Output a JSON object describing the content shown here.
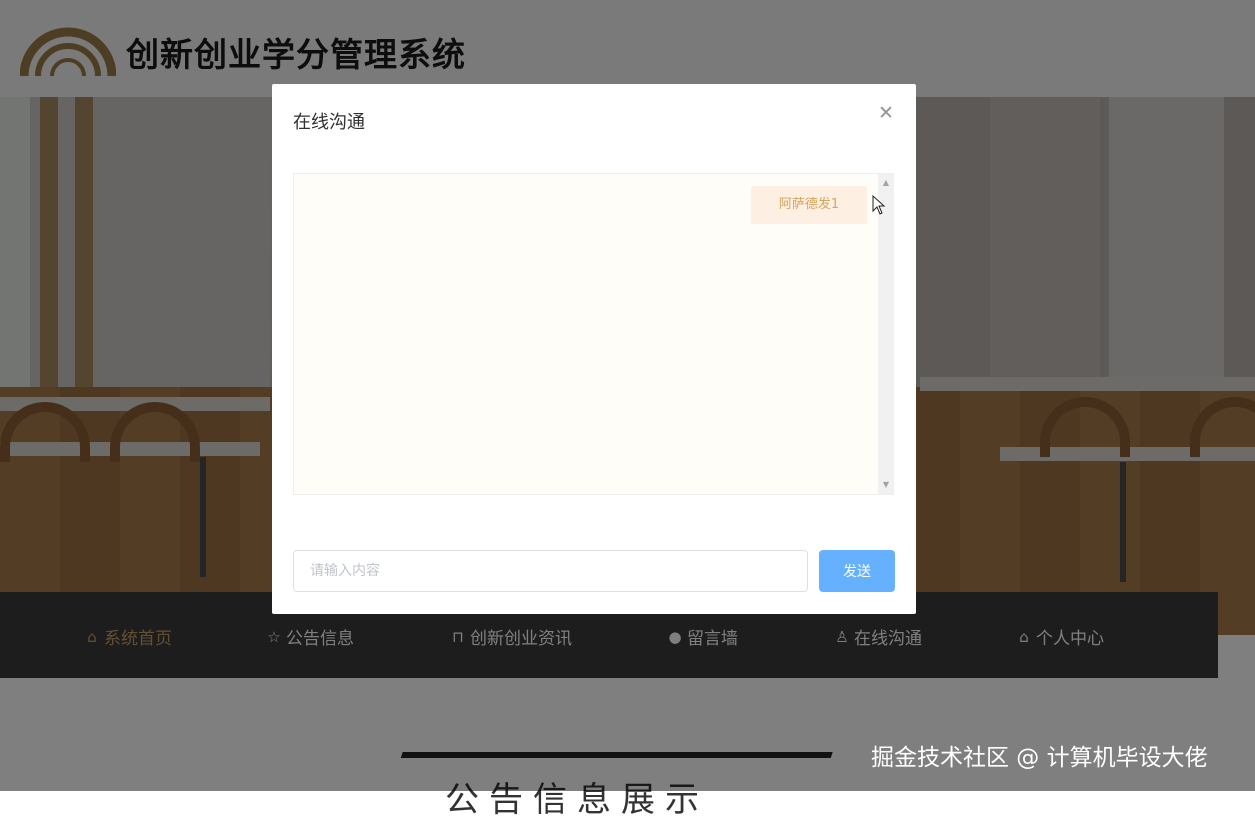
{
  "site": {
    "title": "创新创业学分管理系统",
    "brand_color": "#9a7b45"
  },
  "nav": {
    "items": [
      {
        "label": "系统首页",
        "icon": "home-icon",
        "active": true
      },
      {
        "label": "公告信息",
        "icon": "star-icon",
        "active": false
      },
      {
        "label": "创新创业资讯",
        "icon": "bag-icon",
        "active": false
      },
      {
        "label": "留言墙",
        "icon": "info-icon",
        "active": false
      },
      {
        "label": "在线沟通",
        "icon": "user-icon",
        "active": false
      },
      {
        "label": "个人中心",
        "icon": "home-icon",
        "active": false
      }
    ],
    "active_color": "#c9a163"
  },
  "notice": {
    "title": "公告信息展示"
  },
  "dialog": {
    "title": "在线沟通",
    "close_icon": "close-icon",
    "messages": [
      {
        "text": "阿萨德发1"
      }
    ],
    "input": {
      "placeholder": "请输入内容",
      "value": ""
    },
    "send_label": "发送",
    "send_color": "#66b1ff"
  },
  "watermark": "掘金技术社区 @ 计算机毕设大佬"
}
